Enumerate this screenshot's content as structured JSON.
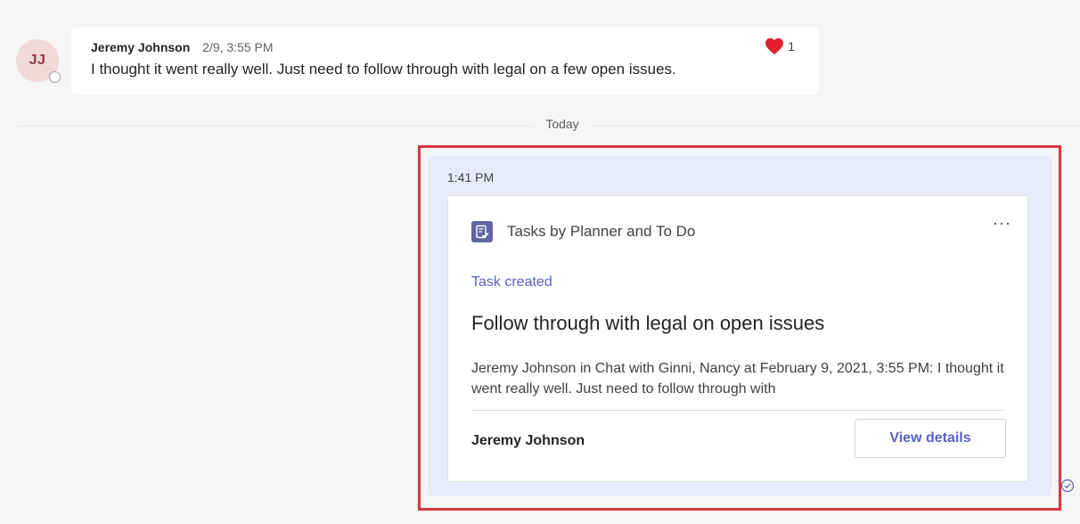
{
  "previous_message": {
    "avatar_initials": "JJ",
    "author": "Jeremy Johnson",
    "timestamp": "2/9, 3:55 PM",
    "text": "I thought it went really well. Just need to follow through with legal on a few open issues.",
    "reaction": {
      "icon": "heart-icon",
      "count": "1",
      "color": "#e0202e"
    }
  },
  "date_divider": {
    "label": "Today"
  },
  "sent_message": {
    "timestamp": "1:41 PM",
    "card": {
      "app_icon": "planner-tasks-icon",
      "app_name": "Tasks by Planner and To Do",
      "more_label": "···",
      "status": "Task created",
      "title": "Follow through with legal on open issues",
      "description": "Jeremy Johnson in Chat with Ginni, Nancy at February 9, 2021, 3:55 PM: I thought it went really well. Just need to follow through with",
      "assignee": "Jeremy Johnson",
      "view_button_label": "View details"
    },
    "read_receipt_icon": "seen-check-icon"
  },
  "colors": {
    "accent": "#5b5fc7",
    "app_icon_bg": "#6264a7",
    "highlight_border": "#d7373f",
    "sent_bubble_bg": "#e8ebfa"
  }
}
